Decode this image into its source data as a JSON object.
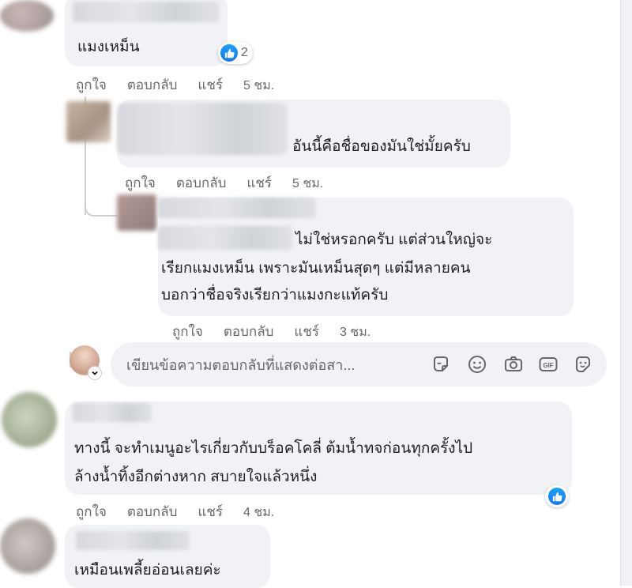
{
  "comments": [
    {
      "text_lines": [
        "แมงเหม็น"
      ],
      "reaction_count": "2",
      "actions": {
        "like": "ถูกใจ",
        "reply": "ตอบกลับ",
        "share": "แชร์",
        "time": "5 ชม."
      }
    },
    {
      "text_lines": [
        "อันนี้คือชื่อของมันใช่มั้ยครับ"
      ],
      "actions": {
        "like": "ถูกใจ",
        "reply": "ตอบกลับ",
        "share": "แชร์",
        "time": "5 ชม."
      }
    },
    {
      "text_lines": [
        "ไม่ใช่หรอกครับ แต่ส่วนใหญ่จะ",
        "เรียกแมงเหม็น เพราะมันเหม็นสุดๆ แต่มีหลายคน",
        "บอกว่าชื่อจริงเรียกว่าแมงกะแท้ครับ"
      ],
      "actions": {
        "like": "ถูกใจ",
        "reply": "ตอบกลับ",
        "share": "แชร์",
        "time": "3 ชม."
      }
    },
    {
      "text_lines": [
        "ทางนี้ จะทำเมนูอะไรเกี่ยวกับบร็อคโคลี่ ต้มน้ำทจก่อนทุกครั้งไป",
        "ล้างน้ำทิ้งอีกต่างหาก สบายใจแล้วหนึ่ง"
      ],
      "actions": {
        "like": "ถูกใจ",
        "reply": "ตอบกลับ",
        "share": "แชร์",
        "time": "4 ชม."
      }
    },
    {
      "text_lines": [
        "เหมือนเพลี้ยอ่อนเลยค่ะ"
      ]
    }
  ],
  "composer": {
    "placeholder": "เขียนข้อความตอบกลับที่แสดงต่อสา..."
  },
  "colors": {
    "bubble": "#f0f2f5",
    "like_blue": "#1877f2",
    "meta_gray": "#65676b"
  }
}
